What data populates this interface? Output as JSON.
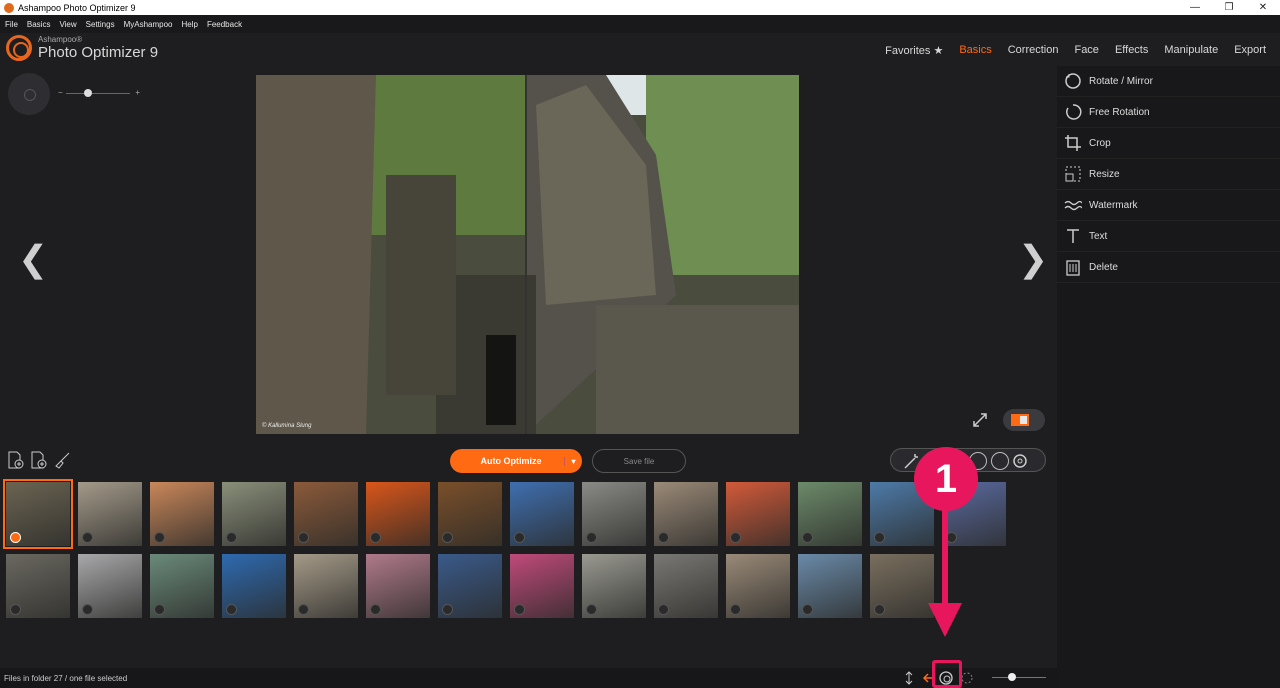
{
  "window": {
    "title": "Ashampoo Photo Optimizer 9",
    "controls": [
      "—",
      "❐",
      "✕"
    ]
  },
  "menu": [
    "File",
    "Basics",
    "View",
    "Settings",
    "MyAshampoo",
    "Help",
    "Feedback"
  ],
  "brand": {
    "small": "Ashampoo®",
    "big": "Photo Optimizer 9"
  },
  "topnav": [
    {
      "label": "Favorites ★",
      "active": false
    },
    {
      "label": "Basics",
      "active": true
    },
    {
      "label": "Correction",
      "active": false
    },
    {
      "label": "Face",
      "active": false
    },
    {
      "label": "Effects",
      "active": false
    },
    {
      "label": "Manipulate",
      "active": false
    },
    {
      "label": "Export",
      "active": false
    }
  ],
  "zoom": {
    "minus": "−",
    "plus": "+",
    "level": 0.4
  },
  "nav": {
    "prev": "❮",
    "next": "❯"
  },
  "photo": {
    "credit": "© Kallumina Slung"
  },
  "basics_panel": [
    {
      "label": "Rotate / Mirror",
      "icon": "rotate-mirror-icon"
    },
    {
      "label": "Free Rotation",
      "icon": "free-rotation-icon"
    },
    {
      "label": "Crop",
      "icon": "crop-icon"
    },
    {
      "label": "Resize",
      "icon": "resize-icon"
    },
    {
      "label": "Watermark",
      "icon": "watermark-icon"
    },
    {
      "label": "Text",
      "icon": "text-icon"
    },
    {
      "label": "Delete",
      "icon": "delete-icon"
    }
  ],
  "toolbar": {
    "auto_optimize": "Auto Optimize",
    "dropdown": "▾",
    "save_file": "Save file"
  },
  "thumbnails": {
    "row1": [
      "#6b6452",
      "#a49a8a",
      "#c9875a",
      "#8a8f7a",
      "#8b5a3a",
      "#d9561a",
      "#7a4f2a",
      "#3f6fb0",
      "#8a8a86",
      "#9b8a78",
      "#d25a3a",
      "#6c8a6a",
      "#4d7aa8",
      "#5a6aa0"
    ],
    "row2": [
      "#6a6860",
      "#a8a8aa",
      "#6a8a7a",
      "#2e6ab0",
      "#a59a88",
      "#b07a8a",
      "#3a5a8a",
      "#c04a7a",
      "#9a9a92",
      "#7a7874",
      "#9a8a78",
      "#6a8aa8",
      "#7a6f5f"
    ],
    "selected_index": 0
  },
  "annotation": {
    "number": "1"
  },
  "status": {
    "text": "Files in folder 27 / one file selected"
  },
  "colors": {
    "accent": "#ff6a13",
    "annotation": "#e8175d"
  }
}
